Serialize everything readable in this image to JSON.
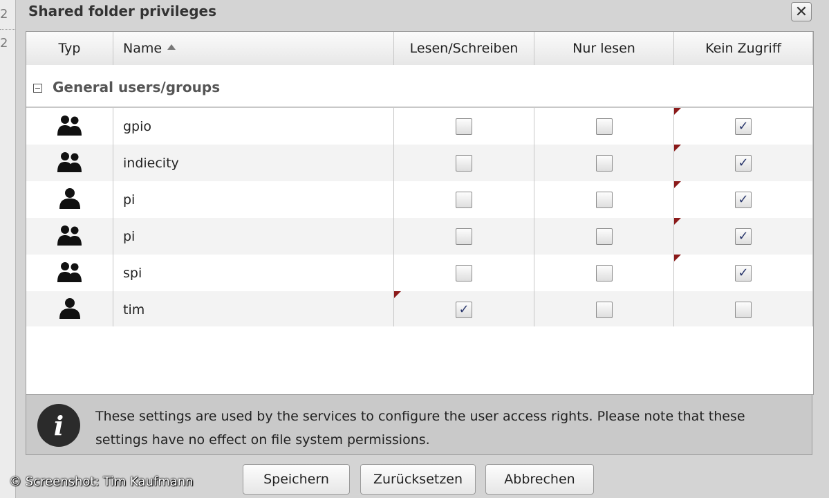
{
  "left_strip": {
    "numbers": [
      "2",
      "2"
    ]
  },
  "dialog": {
    "title": "Shared folder privileges",
    "close_label": "✕"
  },
  "table": {
    "columns": {
      "type": "Typ",
      "name": "Name",
      "rw": "Lesen/Schreiben",
      "ro": "Nur lesen",
      "none": "Kein Zugriff"
    },
    "sort": {
      "column": "Name",
      "direction": "ascending"
    },
    "group": "General users/groups",
    "rows": [
      {
        "type": "group",
        "name": "gpio",
        "rw": false,
        "ro": false,
        "none": true
      },
      {
        "type": "group",
        "name": "indiecity",
        "rw": false,
        "ro": false,
        "none": true
      },
      {
        "type": "user",
        "name": "pi",
        "rw": false,
        "ro": false,
        "none": true
      },
      {
        "type": "group",
        "name": "pi",
        "rw": false,
        "ro": false,
        "none": true
      },
      {
        "type": "group",
        "name": "spi",
        "rw": false,
        "ro": false,
        "none": true
      },
      {
        "type": "user",
        "name": "tim",
        "rw": true,
        "ro": false,
        "none": false
      }
    ]
  },
  "info": {
    "text": "These settings are used by the services to configure the user access rights. Please note that these settings have no effect on file system permissions."
  },
  "buttons": {
    "save": "Speichern",
    "reset": "Zurücksetzen",
    "cancel": "Abbrechen"
  },
  "watermark": "© Screenshot: Tim Kaufmann",
  "colors": {
    "dirty_flag": "#8b1a1a",
    "check": "#28356b"
  }
}
